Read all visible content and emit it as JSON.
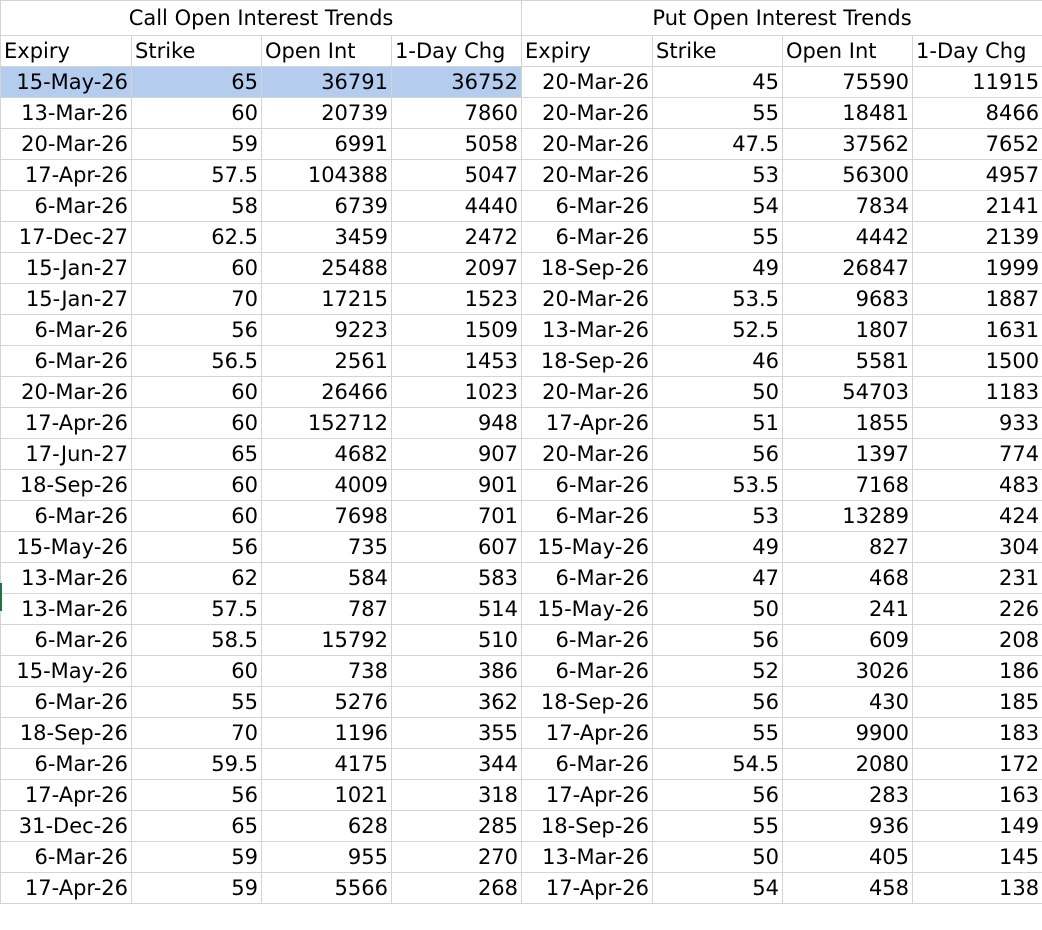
{
  "call_title": "Call Open Interest Trends",
  "put_title": "Put Open Interest Trends",
  "headers": [
    "Expiry",
    "Strike",
    "Open Int",
    "1-Day Chg",
    "Expiry",
    "Strike",
    "Open Int",
    "1-Day Chg"
  ],
  "selected_row": 0,
  "selection_color": "#b4cdef",
  "rows": [
    [
      "15-May-26",
      "65",
      "36791",
      "36752",
      "20-Mar-26",
      "45",
      "75590",
      "11915"
    ],
    [
      "13-Mar-26",
      "60",
      "20739",
      "7860",
      "20-Mar-26",
      "55",
      "18481",
      "8466"
    ],
    [
      "20-Mar-26",
      "59",
      "6991",
      "5058",
      "20-Mar-26",
      "47.5",
      "37562",
      "7652"
    ],
    [
      "17-Apr-26",
      "57.5",
      "104388",
      "5047",
      "20-Mar-26",
      "53",
      "56300",
      "4957"
    ],
    [
      "6-Mar-26",
      "58",
      "6739",
      "4440",
      "6-Mar-26",
      "54",
      "7834",
      "2141"
    ],
    [
      "17-Dec-27",
      "62.5",
      "3459",
      "2472",
      "6-Mar-26",
      "55",
      "4442",
      "2139"
    ],
    [
      "15-Jan-27",
      "60",
      "25488",
      "2097",
      "18-Sep-26",
      "49",
      "26847",
      "1999"
    ],
    [
      "15-Jan-27",
      "70",
      "17215",
      "1523",
      "20-Mar-26",
      "53.5",
      "9683",
      "1887"
    ],
    [
      "6-Mar-26",
      "56",
      "9223",
      "1509",
      "13-Mar-26",
      "52.5",
      "1807",
      "1631"
    ],
    [
      "6-Mar-26",
      "56.5",
      "2561",
      "1453",
      "18-Sep-26",
      "46",
      "5581",
      "1500"
    ],
    [
      "20-Mar-26",
      "60",
      "26466",
      "1023",
      "20-Mar-26",
      "50",
      "54703",
      "1183"
    ],
    [
      "17-Apr-26",
      "60",
      "152712",
      "948",
      "17-Apr-26",
      "51",
      "1855",
      "933"
    ],
    [
      "17-Jun-27",
      "65",
      "4682",
      "907",
      "20-Mar-26",
      "56",
      "1397",
      "774"
    ],
    [
      "18-Sep-26",
      "60",
      "4009",
      "901",
      "6-Mar-26",
      "53.5",
      "7168",
      "483"
    ],
    [
      "6-Mar-26",
      "60",
      "7698",
      "701",
      "6-Mar-26",
      "53",
      "13289",
      "424"
    ],
    [
      "15-May-26",
      "56",
      "735",
      "607",
      "15-May-26",
      "49",
      "827",
      "304"
    ],
    [
      "13-Mar-26",
      "62",
      "584",
      "583",
      "6-Mar-26",
      "47",
      "468",
      "231"
    ],
    [
      "13-Mar-26",
      "57.5",
      "787",
      "514",
      "15-May-26",
      "50",
      "241",
      "226"
    ],
    [
      "6-Mar-26",
      "58.5",
      "15792",
      "510",
      "6-Mar-26",
      "56",
      "609",
      "208"
    ],
    [
      "15-May-26",
      "60",
      "738",
      "386",
      "6-Mar-26",
      "52",
      "3026",
      "186"
    ],
    [
      "6-Mar-26",
      "55",
      "5276",
      "362",
      "18-Sep-26",
      "56",
      "430",
      "185"
    ],
    [
      "18-Sep-26",
      "70",
      "1196",
      "355",
      "17-Apr-26",
      "55",
      "9900",
      "183"
    ],
    [
      "6-Mar-26",
      "59.5",
      "4175",
      "344",
      "6-Mar-26",
      "54.5",
      "2080",
      "172"
    ],
    [
      "17-Apr-26",
      "56",
      "1021",
      "318",
      "17-Apr-26",
      "56",
      "283",
      "163"
    ],
    [
      "31-Dec-26",
      "65",
      "628",
      "285",
      "18-Sep-26",
      "55",
      "936",
      "149"
    ],
    [
      "6-Mar-26",
      "59",
      "955",
      "270",
      "13-Mar-26",
      "50",
      "405",
      "145"
    ],
    [
      "17-Apr-26",
      "59",
      "5566",
      "268",
      "17-Apr-26",
      "54",
      "458",
      "138"
    ]
  ]
}
